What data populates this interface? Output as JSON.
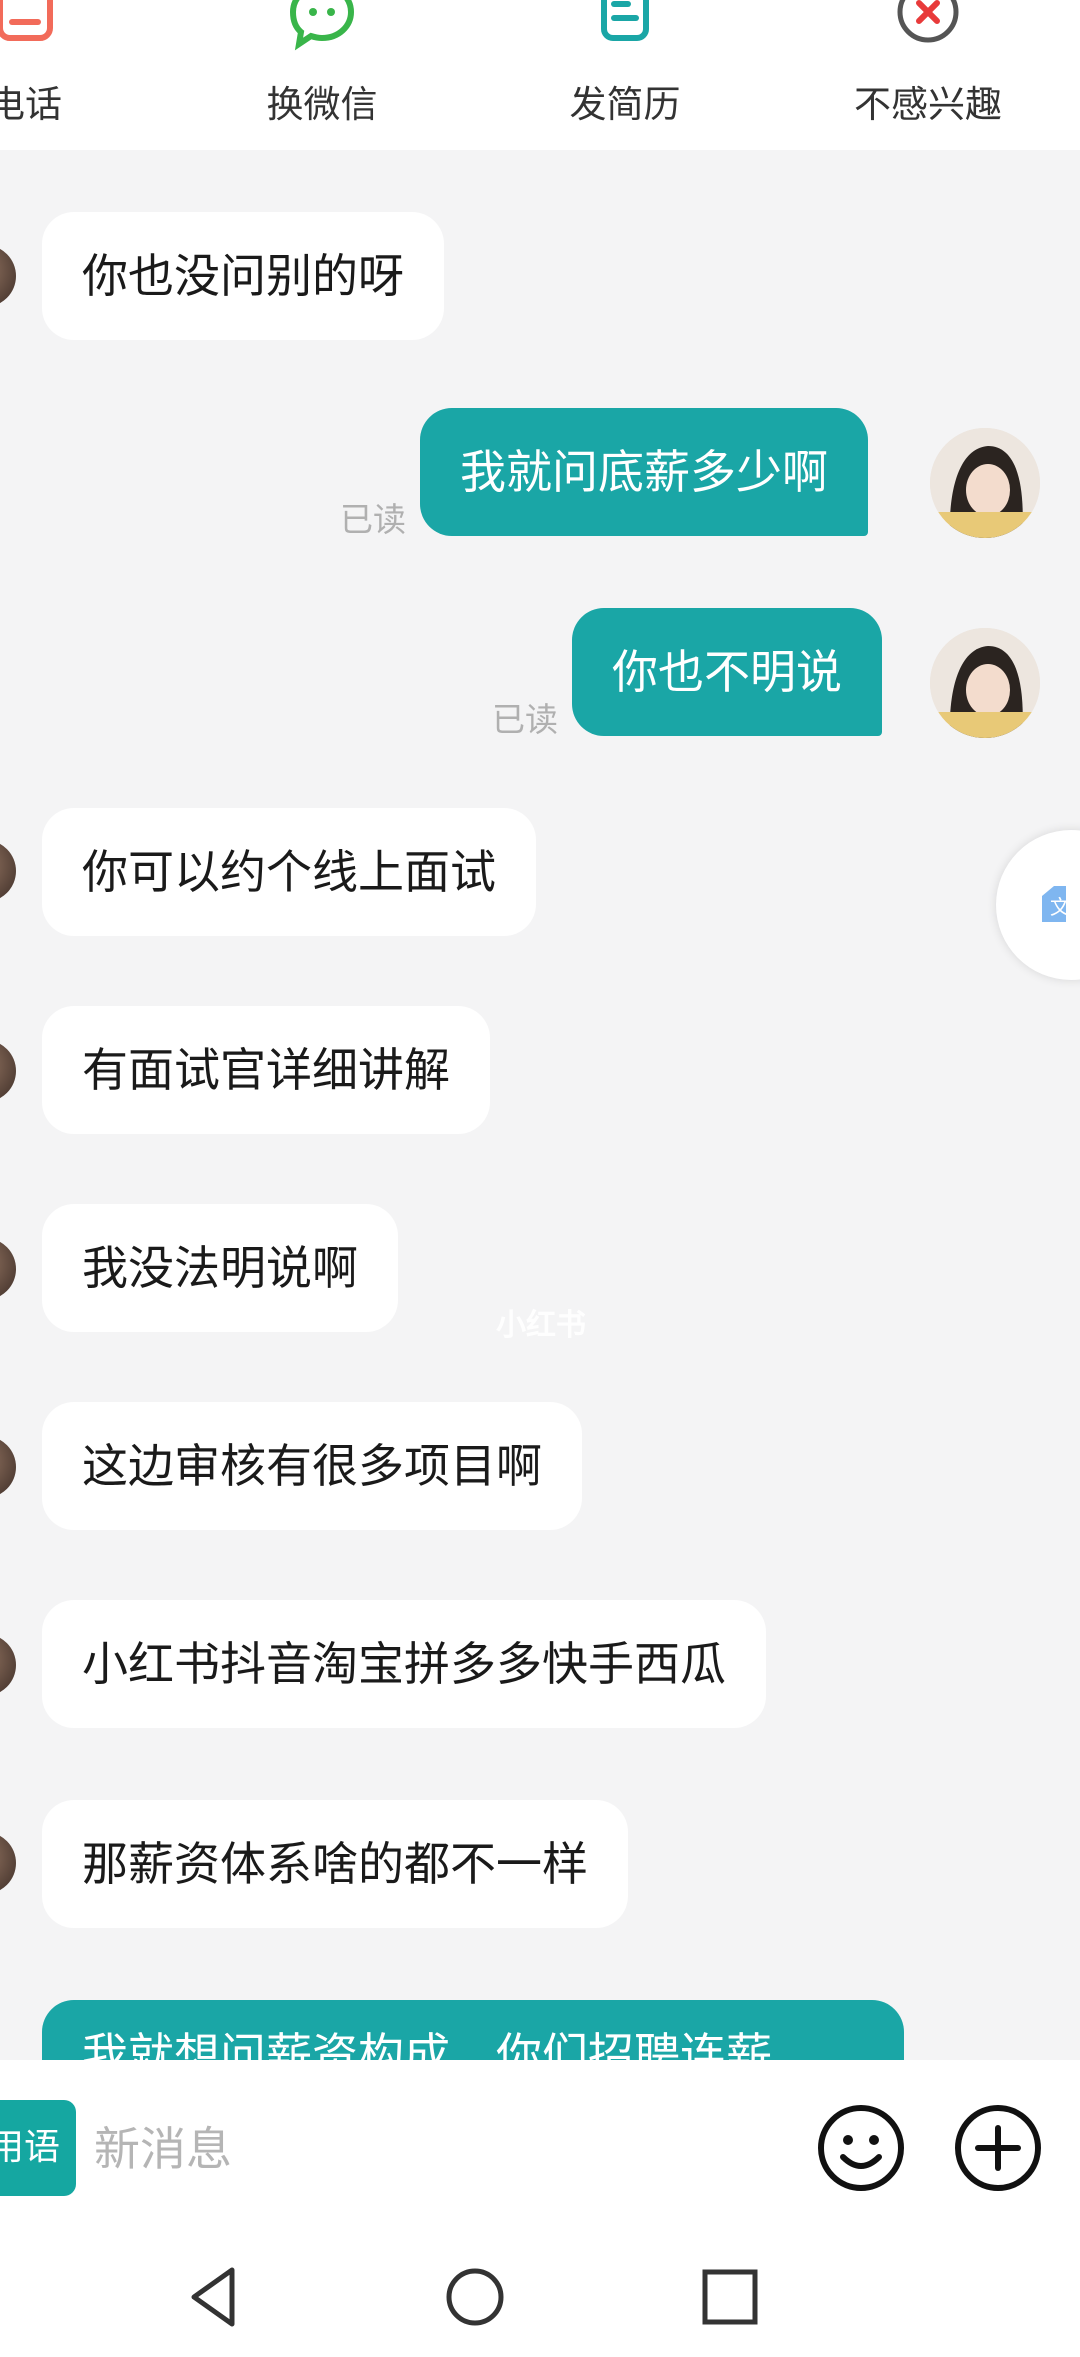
{
  "actions": [
    {
      "label": "电话",
      "icon": "phone-icon"
    },
    {
      "label": "换微信",
      "icon": "wechat-icon"
    },
    {
      "label": "发简历",
      "icon": "resume-icon"
    },
    {
      "label": "不感兴趣",
      "icon": "not-interested-icon"
    }
  ],
  "messages": [
    {
      "dir": "in",
      "text": "你也没问别的呀"
    },
    {
      "dir": "out",
      "text": "我就问底薪多少啊",
      "status": "已读"
    },
    {
      "dir": "out",
      "text": "你也不明说",
      "status": "已读"
    },
    {
      "dir": "in",
      "text": "你可以约个线上面试"
    },
    {
      "dir": "in",
      "text": "有面试官详细讲解"
    },
    {
      "dir": "in",
      "text": "我没法明说啊"
    },
    {
      "dir": "in",
      "text": "这边审核有很多项目啊"
    },
    {
      "dir": "in",
      "text": "小红书抖音淘宝拼多多快手西瓜"
    },
    {
      "dir": "in",
      "text": "那薪资体系啥的都不一样"
    },
    {
      "dir": "out",
      "text": "我就想问薪资构成，你们招聘连薪"
    }
  ],
  "watermark": "小红书",
  "float_button_icon": "translate-icon",
  "input": {
    "phrase_label": "用语",
    "placeholder": "新消息",
    "emoji_icon": "emoji-icon",
    "plus_icon": "plus-icon"
  },
  "nav": [
    "back-icon",
    "home-icon",
    "recents-icon"
  ],
  "colors": {
    "accent": "#1aa6a6",
    "background": "#f4f4f5",
    "read_text": "#b0b0b0"
  }
}
